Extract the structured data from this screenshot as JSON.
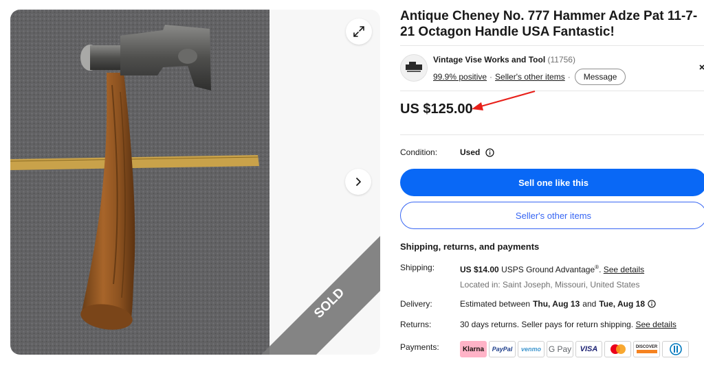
{
  "gallery": {
    "photo_alt": "Antique hammer adze on carpet with ruler",
    "sold_label": "SOLD"
  },
  "listing": {
    "title": "Antique Cheney No. 777 Hammer Adze Pat 11-7-21 Octagon Handle USA Fantastic!",
    "price": "US $125.00"
  },
  "seller": {
    "name": "Vintage Vise Works and Tool",
    "feedback_count": "(11756)",
    "positive": "99.9% positive",
    "other_items_link": "Seller's other items",
    "message_button": "Message"
  },
  "condition": {
    "label": "Condition:",
    "value": "Used"
  },
  "actions": {
    "sell_one_like_this": "Sell one like this",
    "sellers_other_items": "Seller's other items"
  },
  "shipping_section": {
    "heading": "Shipping, returns, and payments",
    "shipping_label": "Shipping:",
    "shipping_cost": "US $14.00",
    "shipping_service": "USPS Ground Advantage",
    "shipping_reg": "®",
    "shipping_period": ".",
    "shipping_details_link": "See details",
    "location": "Located in: Saint Joseph, Missouri, United States",
    "delivery_label": "Delivery:",
    "delivery_prefix": "Estimated between",
    "delivery_start": "Thu, Aug 13",
    "delivery_and": "and",
    "delivery_end": "Tue, Aug 18",
    "returns_label": "Returns:",
    "returns_text": "30 days returns. Seller pays for return shipping.",
    "returns_details_link": "See details",
    "payments_label": "Payments:",
    "payment_methods": {
      "klarna": "Klarna",
      "paypal": "PayPal",
      "venmo": "venmo",
      "gpay": "G Pay",
      "visa": "VISA",
      "discover": "DISCOVER"
    }
  },
  "colors": {
    "primary_button": "#0968f6",
    "link_blue": "#3665f3",
    "arrow_red": "#e8201a"
  }
}
